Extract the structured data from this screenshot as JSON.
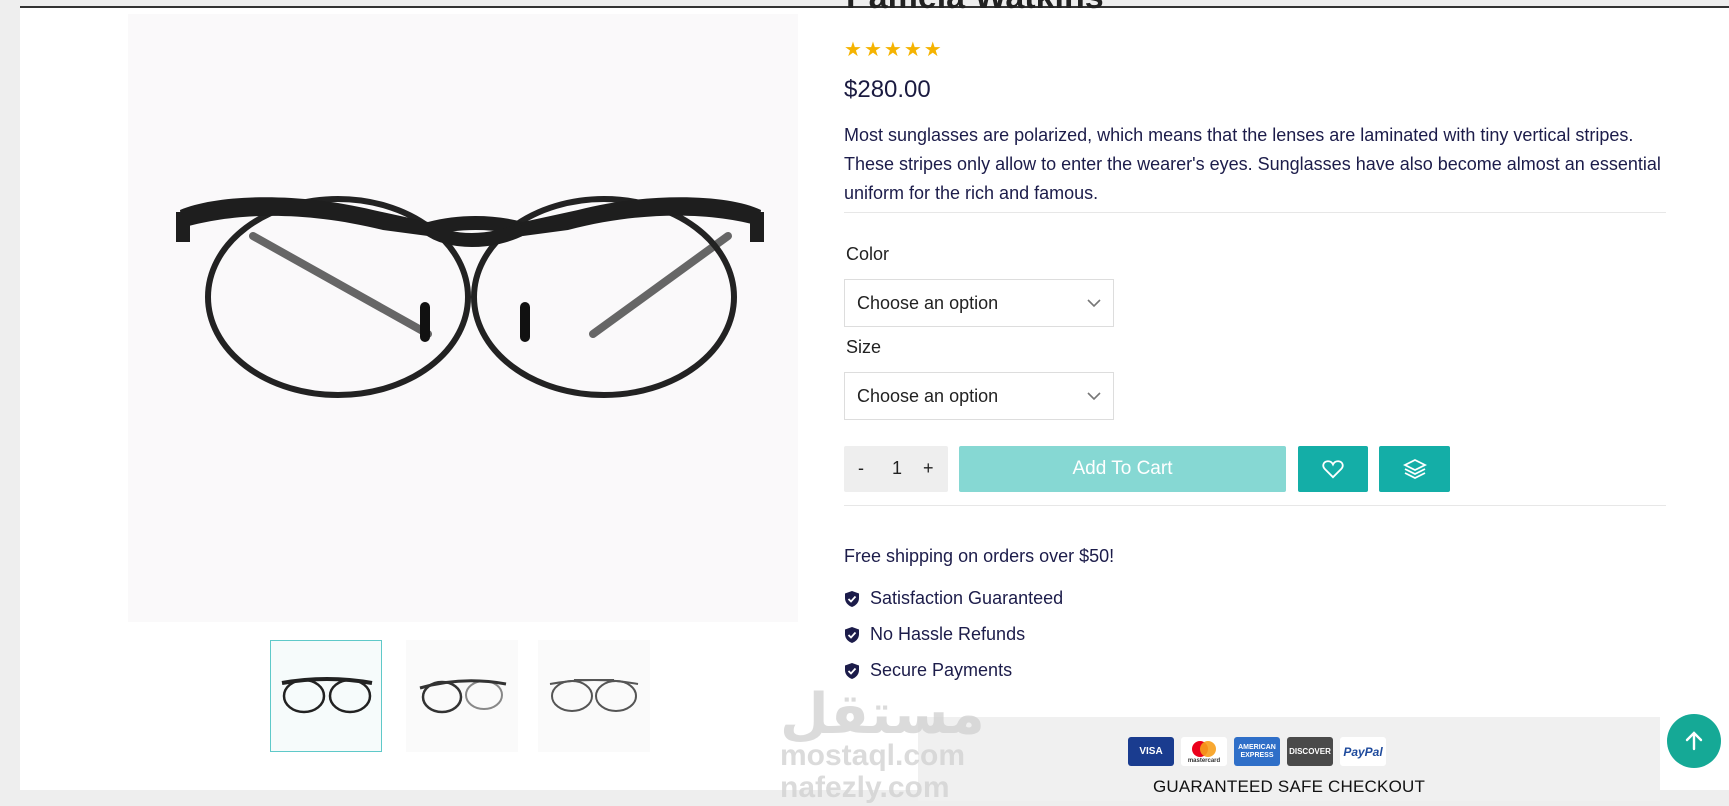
{
  "product": {
    "title": "Pamela Watkins",
    "rating": 5,
    "price": "$280.00",
    "description": "Most sunglasses are polarized, which means that the lenses are laminated with tiny vertical stripes. These stripes only allow to enter the wearer's eyes. Sunglasses have also become almost an essential uniform for the rich and famous."
  },
  "options": {
    "color_label": "Color",
    "color_value": "Choose an option",
    "size_label": "Size",
    "size_value": "Choose an option"
  },
  "cart": {
    "minus": "-",
    "quantity": "1",
    "plus": "+",
    "add_to_cart": "Add To Cart",
    "wishlist_icon": "heart-icon",
    "compare_icon": "layers-icon"
  },
  "shipping": {
    "note": "Free shipping on orders over $50!",
    "features": [
      "Satisfaction Guaranteed",
      "No Hassle Refunds",
      "Secure Payments"
    ]
  },
  "checkout": {
    "cards": [
      "VISA",
      "mastercard",
      "AMERICAN EXPRESS",
      "DISCOVER",
      "PayPal"
    ],
    "text": "GUARANTEED SAFE CHECKOUT"
  },
  "watermark": {
    "line1": "مستقل",
    "line2": "mostaql.com",
    "line3": "nafezly.com"
  },
  "colors": {
    "accent": "#14aea7",
    "accent_light": "#86d8d3",
    "star": "#f5b301",
    "text": "#1c1c4a"
  }
}
